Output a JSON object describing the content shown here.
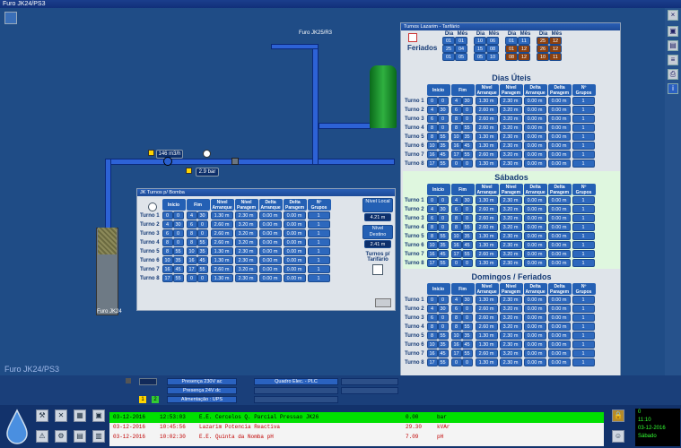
{
  "title": "Furo JK24/PS3",
  "main": {
    "well_label": "Furo JK24",
    "furo_top_label": "Furo JK25/R3",
    "flow_value": "146 m3/h",
    "pressure_value": "2.9 bar",
    "station_label": "Furo JK24/PS3"
  },
  "local_panel": {
    "title": "JK Turnos p/ Bomba",
    "headers": [
      "Início",
      "Fim",
      "Nível Arranque",
      "Nível Paragem",
      "Delta Arranque",
      "Delta Paragem",
      "Nº Grupos"
    ],
    "rows": [
      {
        "label": "Turno 1",
        "ih": "0",
        "im": "0",
        "fh": "4",
        "fm": "30",
        "na": "1.30 m",
        "np": "2.30 m",
        "da": "0.00 m",
        "dp": "0.00 m",
        "g": "1"
      },
      {
        "label": "Turno 2",
        "ih": "4",
        "im": "30",
        "fh": "6",
        "fm": "0",
        "na": "2.60 m",
        "np": "3.20 m",
        "da": "0.00 m",
        "dp": "0.00 m",
        "g": "1"
      },
      {
        "label": "Turno 3",
        "ih": "6",
        "im": "0",
        "fh": "8",
        "fm": "0",
        "na": "2.60 m",
        "np": "3.20 m",
        "da": "0.00 m",
        "dp": "0.00 m",
        "g": "1"
      },
      {
        "label": "Turno 4",
        "ih": "8",
        "im": "0",
        "fh": "8",
        "fm": "55",
        "na": "2.60 m",
        "np": "3.20 m",
        "da": "0.00 m",
        "dp": "0.00 m",
        "g": "1"
      },
      {
        "label": "Turno 5",
        "ih": "8",
        "im": "55",
        "fh": "10",
        "fm": "35",
        "na": "1.30 m",
        "np": "2.30 m",
        "da": "0.00 m",
        "dp": "0.00 m",
        "g": "1"
      },
      {
        "label": "Turno 6",
        "ih": "10",
        "im": "35",
        "fh": "16",
        "fm": "45",
        "na": "1.30 m",
        "np": "2.30 m",
        "da": "0.00 m",
        "dp": "0.00 m",
        "g": "1"
      },
      {
        "label": "Turno 7",
        "ih": "16",
        "im": "45",
        "fh": "17",
        "fm": "55",
        "na": "2.60 m",
        "np": "3.20 m",
        "da": "0.00 m",
        "dp": "0.00 m",
        "g": "1"
      },
      {
        "label": "Turno 8",
        "ih": "17",
        "im": "55",
        "fh": "0",
        "fm": "0",
        "na": "1.30 m",
        "np": "2.30 m",
        "da": "0.00 m",
        "dp": "0.00 m",
        "g": "1"
      }
    ],
    "nivel_local_label": "Nível Local",
    "nivel_local_value": "4.21 m",
    "nivel_destino_label": "Nível Destino",
    "nivel_destino_value": "2.41 m",
    "turnos_tarifario": "Turnos p/ Tarifário"
  },
  "tarif_panel": {
    "title": "Turnos Lazarim - Tarifário",
    "feriados_label": "Feriados",
    "dia_label": "Dia",
    "mes_label": "Mês",
    "holidays": [
      [
        [
          "01",
          "01"
        ],
        [
          "25",
          "04"
        ],
        [
          "01",
          "05"
        ]
      ],
      [
        [
          "10",
          "06"
        ],
        [
          "15",
          "08"
        ],
        [
          "05",
          "10"
        ]
      ],
      [
        [
          "01",
          "11"
        ],
        [
          "01",
          "12"
        ],
        [
          "08",
          "12"
        ]
      ],
      [
        [
          "25",
          "12"
        ],
        [
          "26",
          "12"
        ],
        [
          "10",
          "11"
        ]
      ]
    ],
    "sections": [
      {
        "title": "Dias Úteis",
        "rows": [
          [
            "0",
            "0",
            "4",
            "30",
            "1.30 m",
            "2.30 m",
            "0.00 m",
            "0.00 m",
            "1"
          ],
          [
            "4",
            "30",
            "6",
            "0",
            "2.60 m",
            "3.20 m",
            "0.00 m",
            "0.00 m",
            "1"
          ],
          [
            "6",
            "0",
            "8",
            "0",
            "2.60 m",
            "3.20 m",
            "0.00 m",
            "0.00 m",
            "1"
          ],
          [
            "8",
            "0",
            "8",
            "55",
            "2.60 m",
            "3.20 m",
            "0.00 m",
            "0.00 m",
            "1"
          ],
          [
            "8",
            "55",
            "10",
            "35",
            "1.30 m",
            "2.30 m",
            "0.00 m",
            "0.00 m",
            "1"
          ],
          [
            "10",
            "35",
            "16",
            "45",
            "1.30 m",
            "2.30 m",
            "0.00 m",
            "0.00 m",
            "1"
          ],
          [
            "16",
            "45",
            "17",
            "55",
            "2.60 m",
            "3.20 m",
            "0.00 m",
            "0.00 m",
            "1"
          ],
          [
            "17",
            "55",
            "0",
            "0",
            "1.30 m",
            "2.30 m",
            "0.00 m",
            "0.00 m",
            "1"
          ]
        ]
      },
      {
        "title": "Sábados",
        "rows": [
          [
            "0",
            "0",
            "4",
            "30",
            "1.30 m",
            "2.30 m",
            "0.00 m",
            "0.00 m",
            "1"
          ],
          [
            "4",
            "30",
            "6",
            "0",
            "2.60 m",
            "3.20 m",
            "0.00 m",
            "0.00 m",
            "1"
          ],
          [
            "6",
            "0",
            "8",
            "0",
            "2.60 m",
            "3.20 m",
            "0.00 m",
            "0.00 m",
            "1"
          ],
          [
            "8",
            "0",
            "8",
            "55",
            "2.60 m",
            "3.20 m",
            "0.00 m",
            "0.00 m",
            "1"
          ],
          [
            "8",
            "55",
            "10",
            "35",
            "1.30 m",
            "2.30 m",
            "0.00 m",
            "0.00 m",
            "1"
          ],
          [
            "10",
            "35",
            "16",
            "45",
            "1.30 m",
            "2.30 m",
            "0.00 m",
            "0.00 m",
            "1"
          ],
          [
            "16",
            "45",
            "17",
            "55",
            "2.60 m",
            "3.20 m",
            "0.00 m",
            "0.00 m",
            "1"
          ],
          [
            "17",
            "55",
            "0",
            "0",
            "1.30 m",
            "2.30 m",
            "0.00 m",
            "0.00 m",
            "1"
          ]
        ]
      },
      {
        "title": "Domingos / Feriados",
        "rows": [
          [
            "0",
            "0",
            "4",
            "30",
            "1.30 m",
            "2.30 m",
            "0.00 m",
            "0.00 m",
            "1"
          ],
          [
            "4",
            "30",
            "6",
            "0",
            "2.60 m",
            "3.20 m",
            "0.00 m",
            "0.00 m",
            "1"
          ],
          [
            "6",
            "0",
            "8",
            "0",
            "2.60 m",
            "3.20 m",
            "0.00 m",
            "0.00 m",
            "1"
          ],
          [
            "8",
            "0",
            "8",
            "55",
            "2.60 m",
            "3.20 m",
            "0.00 m",
            "0.00 m",
            "1"
          ],
          [
            "8",
            "55",
            "10",
            "35",
            "1.30 m",
            "2.30 m",
            "0.00 m",
            "0.00 m",
            "1"
          ],
          [
            "10",
            "35",
            "16",
            "45",
            "1.30 m",
            "2.30 m",
            "0.00 m",
            "0.00 m",
            "1"
          ],
          [
            "16",
            "45",
            "17",
            "55",
            "2.60 m",
            "3.20 m",
            "0.00 m",
            "0.00 m",
            "1"
          ],
          [
            "17",
            "55",
            "0",
            "0",
            "1.30 m",
            "2.30 m",
            "0.00 m",
            "0.00 m",
            "1"
          ]
        ]
      }
    ],
    "turno_labels": [
      "Turno 1",
      "Turno 2",
      "Turno 3",
      "Turno 4",
      "Turno 5",
      "Turno 6",
      "Turno 7",
      "Turno 8"
    ]
  },
  "status": {
    "presenca_230": "Presença 230V ac",
    "presenca_24": "Presença 24V dc",
    "alimentacao": "Alimentação : UPS",
    "quadro": "Quadro Elec. - PLC",
    "box1": "1",
    "box2": "2"
  },
  "alarms": [
    {
      "date": "03-12-2016",
      "time": "12:53:03",
      "text": "E.E. Cercelos Q. Parcial Pressao JK26",
      "value": "0.00",
      "unit": "bar",
      "color": "#000"
    },
    {
      "date": "03-12-2016",
      "time": "10:45:56",
      "text": "Lazarim Potencia Reactiva",
      "value": "29.30",
      "unit": "kVAr",
      "color": "#c00000"
    },
    {
      "date": "03-12-2016",
      "time": "10:02:30",
      "text": "E.E. Quinta da Nomba pH",
      "value": "7.09",
      "unit": "pH",
      "color": "#c00000"
    }
  ],
  "clock": {
    "zero": "0",
    "time": "11:10",
    "date": "03-12-2016",
    "day": "Sábado"
  }
}
